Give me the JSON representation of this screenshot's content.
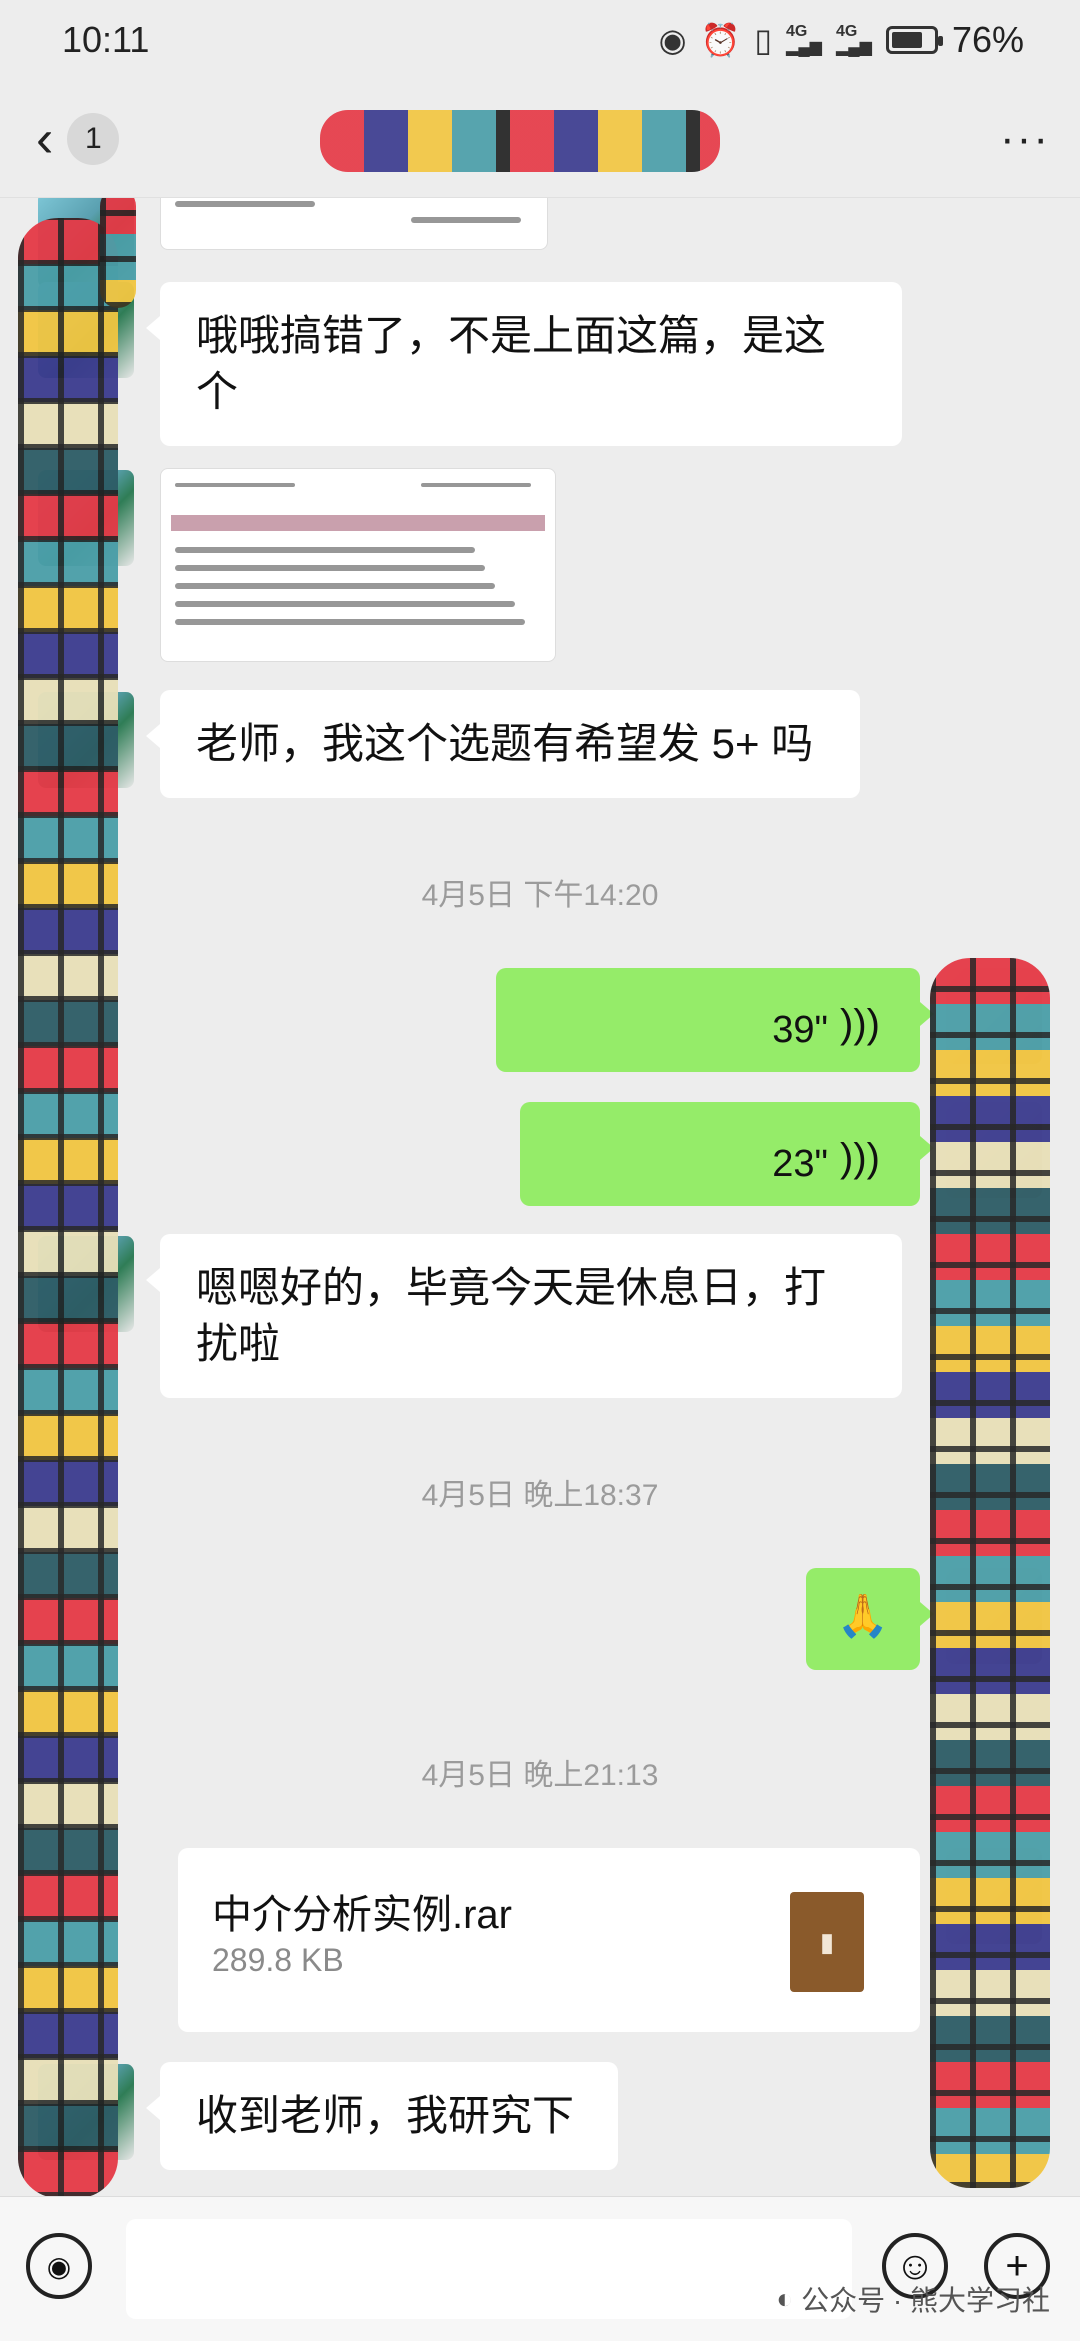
{
  "status_bar": {
    "time": "10:11",
    "battery_level": 0.76,
    "battery_text": "76%",
    "signal_labels": [
      "4G",
      "4G"
    ],
    "icons": [
      "eye-icon",
      "alarm-icon",
      "vibrate-icon",
      "signal-icon",
      "signal-icon",
      "battery-icon"
    ]
  },
  "header": {
    "back_symbol": "‹",
    "unread_count": "1",
    "more_symbol": "···"
  },
  "messages": {
    "m1": {
      "side": "left",
      "text": "哦哦搞错了，不是上面这篇，是这个"
    },
    "m2_image": {
      "side": "left",
      "type": "image"
    },
    "m3": {
      "side": "left",
      "text": "老师，我这个选题有希望发 5+ 吗"
    },
    "ts1": "4月5日 下午14:20",
    "v1": {
      "side": "right",
      "duration": "39\""
    },
    "v2": {
      "side": "right",
      "duration": "23\""
    },
    "m4": {
      "side": "left",
      "text": "嗯嗯好的，毕竟今天是休息日，打扰啦"
    },
    "ts2": "4月5日 晚上18:37",
    "m5_emoji": {
      "side": "right",
      "glyph": "🙏"
    },
    "ts3": "4月5日 晚上21:13",
    "file": {
      "side": "right",
      "name": "中介分析实例.rar",
      "size": "289.8 KB"
    },
    "m6": {
      "side": "left",
      "text": "收到老师，我研究下"
    }
  },
  "input_bar": {
    "voice_glyph": "◉",
    "emoji_glyph": "☺",
    "plus_glyph": "+",
    "watermark": "公众号 · 熊大学习社"
  },
  "colors": {
    "background": "#ededed",
    "bubble_right": "#95ec69",
    "bubble_left": "#ffffff",
    "timestamp": "#9b9b9b"
  }
}
